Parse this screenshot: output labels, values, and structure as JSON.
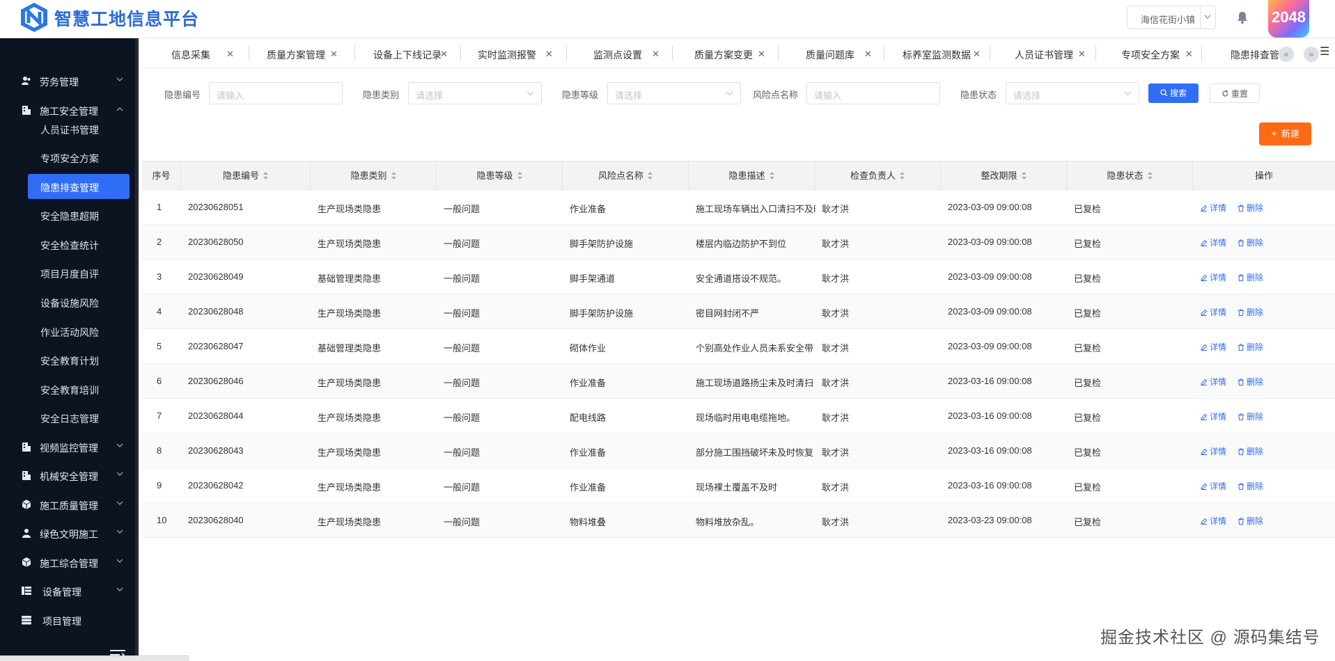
{
  "header": {
    "brand": "智慧工地信息平台",
    "site_select": "海信花街小镇",
    "badge": "2048"
  },
  "sidebar": {
    "groups_top": [
      {
        "label": "劳务管理",
        "icon": "users-icon"
      },
      {
        "label": "施工安全管理",
        "icon": "building-icon"
      }
    ],
    "items": [
      {
        "label": "人员证书管理",
        "active": false
      },
      {
        "label": "专项安全方案",
        "active": false
      },
      {
        "label": "隐患排查管理",
        "active": true
      },
      {
        "label": "安全隐患超期",
        "active": false
      },
      {
        "label": "安全检查统计",
        "active": false
      },
      {
        "label": "项目月度自评",
        "active": false
      },
      {
        "label": "设备设施风险",
        "active": false
      },
      {
        "label": "作业活动风险",
        "active": false
      },
      {
        "label": "安全教育计划",
        "active": false
      },
      {
        "label": "安全教育培训",
        "active": false
      },
      {
        "label": "安全日志管理",
        "active": false
      }
    ],
    "groups_bottom": [
      {
        "label": "视频监控管理",
        "icon": "building-icon",
        "arrow": true
      },
      {
        "label": "机械安全管理",
        "icon": "building-icon",
        "arrow": true
      },
      {
        "label": "施工质量管理",
        "icon": "cube-icon",
        "arrow": true
      },
      {
        "label": "绿色文明施工",
        "icon": "person-icon",
        "arrow": true
      },
      {
        "label": "施工综合管理",
        "icon": "cube-icon",
        "arrow": true
      },
      {
        "label": "设备管理",
        "icon": "list-icon",
        "arrow": true
      },
      {
        "label": "项目管理",
        "icon": "database-icon",
        "arrow": false
      }
    ]
  },
  "tabs": [
    {
      "label": "信息采集"
    },
    {
      "label": "质量方案管理"
    },
    {
      "label": "设备上下线记录"
    },
    {
      "label": "实时监测报警"
    },
    {
      "label": "监测点设置"
    },
    {
      "label": "质量方案变更"
    },
    {
      "label": "质量问题库"
    },
    {
      "label": "标养室监测数据"
    },
    {
      "label": "人员证书管理"
    },
    {
      "label": "专项安全方案"
    },
    {
      "label": "隐患排查管"
    }
  ],
  "filters": {
    "code_label": "隐患编号",
    "code_placeholder": "请输入",
    "type_label": "隐患类别",
    "type_placeholder": "请选择",
    "level_label": "隐患等级",
    "level_placeholder": "请选择",
    "risk_label": "风险点名称",
    "risk_placeholder": "请输入",
    "status_label": "隐患状态",
    "status_placeholder": "请选择",
    "search": "搜索",
    "reset": "重置",
    "new": "新建"
  },
  "table": {
    "columns": [
      "序号",
      "隐患编号",
      "隐患类别",
      "隐患等级",
      "风险点名称",
      "隐患描述",
      "检查负责人",
      "整改期限",
      "隐患状态",
      "操作"
    ],
    "detail_label": "详情",
    "delete_label": "删除",
    "rows": [
      {
        "no": "1",
        "code": "20230628051",
        "type": "生产现场类隐患",
        "level": "一般问题",
        "risk": "作业准备",
        "desc": "施工现场车辆出入口清扫不及时",
        "owner": "耿才洪",
        "deadline": "2023-03-09 09:00:08",
        "status": "已复检"
      },
      {
        "no": "2",
        "code": "20230628050",
        "type": "生产现场类隐患",
        "level": "一般问题",
        "risk": "脚手架防护设施",
        "desc": "楼层内临边防护不到位",
        "owner": "耿才洪",
        "deadline": "2023-03-09 09:00:08",
        "status": "已复检"
      },
      {
        "no": "3",
        "code": "20230628049",
        "type": "基础管理类隐患",
        "level": "一般问题",
        "risk": "脚手架通道",
        "desc": "安全通道搭设不规范。",
        "owner": "耿才洪",
        "deadline": "2023-03-09 09:00:08",
        "status": "已复检"
      },
      {
        "no": "4",
        "code": "20230628048",
        "type": "生产现场类隐患",
        "level": "一般问题",
        "risk": "脚手架防护设施",
        "desc": "密目网封闭不严",
        "owner": "耿才洪",
        "deadline": "2023-03-09 09:00:08",
        "status": "已复检"
      },
      {
        "no": "5",
        "code": "20230628047",
        "type": "基础管理类隐患",
        "level": "一般问题",
        "risk": "砌体作业",
        "desc": "个别高处作业人员未系安全带",
        "owner": "耿才洪",
        "deadline": "2023-03-09 09:00:08",
        "status": "已复检"
      },
      {
        "no": "6",
        "code": "20230628046",
        "type": "生产现场类隐患",
        "level": "一般问题",
        "risk": "作业准备",
        "desc": "施工现场道路扬尘未及时清扫",
        "owner": "耿才洪",
        "deadline": "2023-03-16 09:00:08",
        "status": "已复检"
      },
      {
        "no": "7",
        "code": "20230628044",
        "type": "生产现场类隐患",
        "level": "一般问题",
        "risk": "配电线路",
        "desc": "现场临时用电电缆拖地。",
        "owner": "耿才洪",
        "deadline": "2023-03-16 09:00:08",
        "status": "已复检"
      },
      {
        "no": "8",
        "code": "20230628043",
        "type": "生产现场类隐患",
        "level": "一般问题",
        "risk": "作业准备",
        "desc": "部分施工围挡破坏未及时恢复",
        "owner": "耿才洪",
        "deadline": "2023-03-16 09:00:08",
        "status": "已复检"
      },
      {
        "no": "9",
        "code": "20230628042",
        "type": "生产现场类隐患",
        "level": "一般问题",
        "risk": "作业准备",
        "desc": "现场裸土覆盖不及时",
        "owner": "耿才洪",
        "deadline": "2023-03-16 09:00:08",
        "status": "已复检"
      },
      {
        "no": "10",
        "code": "20230628040",
        "type": "生产现场类隐患",
        "level": "一般问题",
        "risk": "物料堆叠",
        "desc": "物料堆放杂乱。",
        "owner": "耿才洪",
        "deadline": "2023-03-23 09:00:08",
        "status": "已复检"
      }
    ]
  },
  "watermark": "掘金技术社区 @ 源码集结号",
  "colors": {
    "primary": "#2f6df6",
    "accent": "#ff6a14",
    "sidebar_bg": "#0c1321"
  }
}
